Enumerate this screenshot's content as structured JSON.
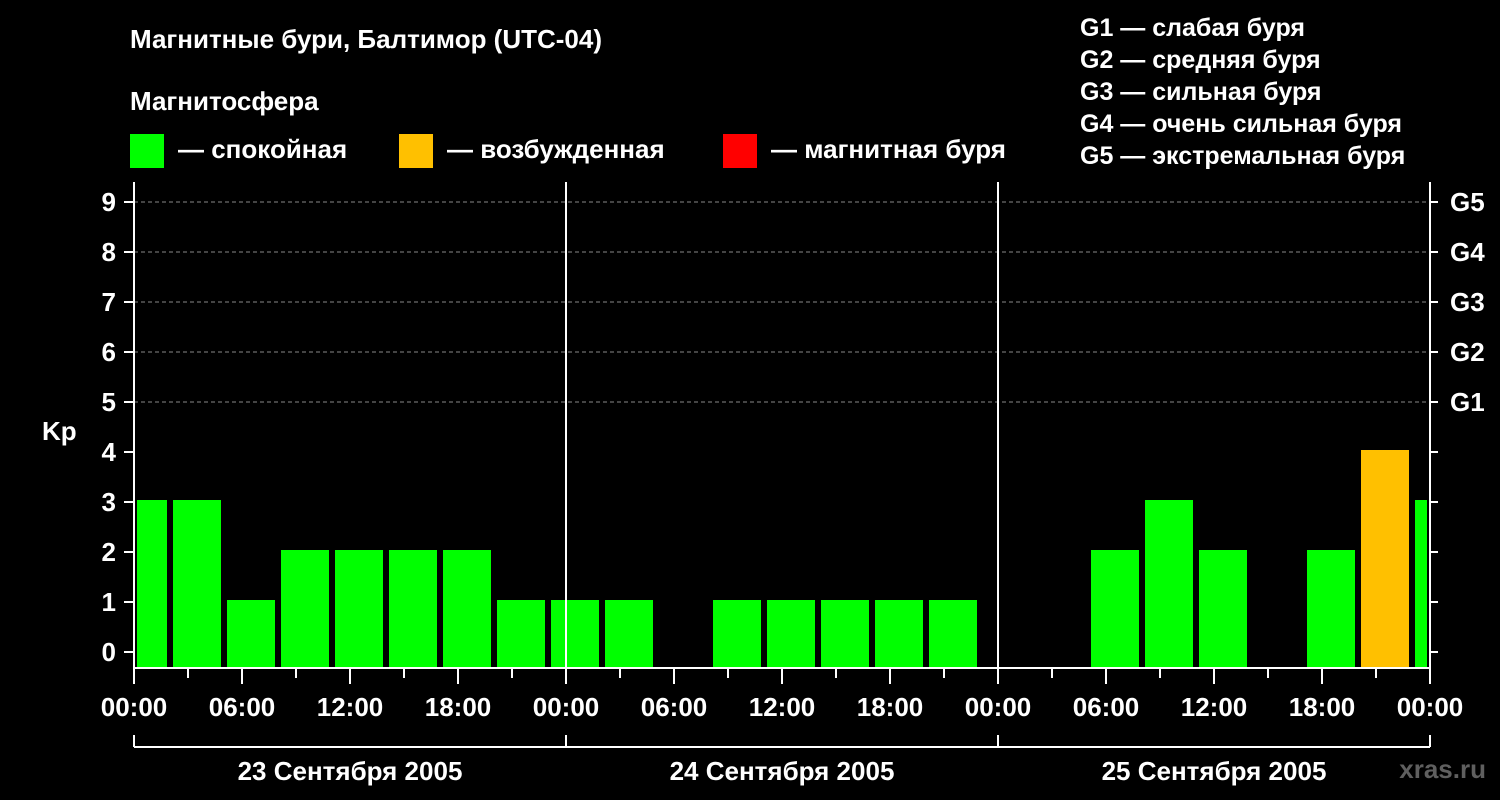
{
  "colors": {
    "quiet": "#00ff00",
    "active": "#ffc000",
    "storm": "#ff0000",
    "background": "#000000",
    "axis": "#ffffff",
    "grid": "#888888",
    "watermark": "#5f5f5f"
  },
  "watermark": "xras.ru",
  "legend": {
    "title": "Магнитосфера",
    "items": [
      {
        "color": "#00ff00",
        "label": "— спокойная"
      },
      {
        "color": "#ffc000",
        "label": "— возбужденная"
      },
      {
        "color": "#ff0000",
        "label": "— магнитная буря"
      }
    ],
    "g_levels": [
      "G1 — слабая буря",
      "G2 — средняя буря",
      "G3 — сильная буря",
      "G4 — очень сильная буря",
      "G5 — экстремальная буря"
    ]
  },
  "chart_data": {
    "type": "bar",
    "title": "Магнитные бури, Балтимор (UTC-04)",
    "ylabel": "Kp",
    "ylim": [
      0,
      9
    ],
    "yticks": [
      0,
      1,
      2,
      3,
      4,
      5,
      6,
      7,
      8,
      9
    ],
    "right_axis_labels": [
      {
        "kp": 5,
        "label": "G1"
      },
      {
        "kp": 6,
        "label": "G2"
      },
      {
        "kp": 7,
        "label": "G3"
      },
      {
        "kp": 8,
        "label": "G4"
      },
      {
        "kp": 9,
        "label": "G5"
      }
    ],
    "grid": "horizontal dashed at Kp 5–9",
    "x_range_hours": [
      0,
      72
    ],
    "x_tick_labels": [
      "00:00",
      "06:00",
      "12:00",
      "18:00",
      "00:00",
      "06:00",
      "12:00",
      "18:00",
      "00:00",
      "06:00",
      "12:00",
      "18:00",
      "00:00"
    ],
    "days": [
      "23 Сентября 2005",
      "24 Сентября 2005",
      "25 Сентября 2005"
    ],
    "bars": [
      {
        "start": 0,
        "end": 2,
        "kp": 3,
        "level": "quiet"
      },
      {
        "start": 2,
        "end": 5,
        "kp": 3,
        "level": "quiet"
      },
      {
        "start": 5,
        "end": 8,
        "kp": 1,
        "level": "quiet"
      },
      {
        "start": 8,
        "end": 11,
        "kp": 2,
        "level": "quiet"
      },
      {
        "start": 11,
        "end": 14,
        "kp": 2,
        "level": "quiet"
      },
      {
        "start": 14,
        "end": 17,
        "kp": 2,
        "level": "quiet"
      },
      {
        "start": 17,
        "end": 20,
        "kp": 2,
        "level": "quiet"
      },
      {
        "start": 20,
        "end": 23,
        "kp": 1,
        "level": "quiet"
      },
      {
        "start": 23,
        "end": 26,
        "kp": 1,
        "level": "quiet"
      },
      {
        "start": 26,
        "end": 29,
        "kp": 1,
        "level": "quiet"
      },
      {
        "start": 32,
        "end": 35,
        "kp": 1,
        "level": "quiet"
      },
      {
        "start": 35,
        "end": 38,
        "kp": 1,
        "level": "quiet"
      },
      {
        "start": 38,
        "end": 41,
        "kp": 1,
        "level": "quiet"
      },
      {
        "start": 41,
        "end": 44,
        "kp": 1,
        "level": "quiet"
      },
      {
        "start": 44,
        "end": 47,
        "kp": 1,
        "level": "quiet"
      },
      {
        "start": 53,
        "end": 56,
        "kp": 2,
        "level": "quiet"
      },
      {
        "start": 56,
        "end": 59,
        "kp": 3,
        "level": "quiet"
      },
      {
        "start": 59,
        "end": 62,
        "kp": 2,
        "level": "quiet"
      },
      {
        "start": 65,
        "end": 68,
        "kp": 2,
        "level": "quiet"
      },
      {
        "start": 68,
        "end": 71,
        "kp": 4,
        "level": "active"
      },
      {
        "start": 71,
        "end": 72,
        "kp": 3,
        "level": "quiet"
      }
    ]
  }
}
